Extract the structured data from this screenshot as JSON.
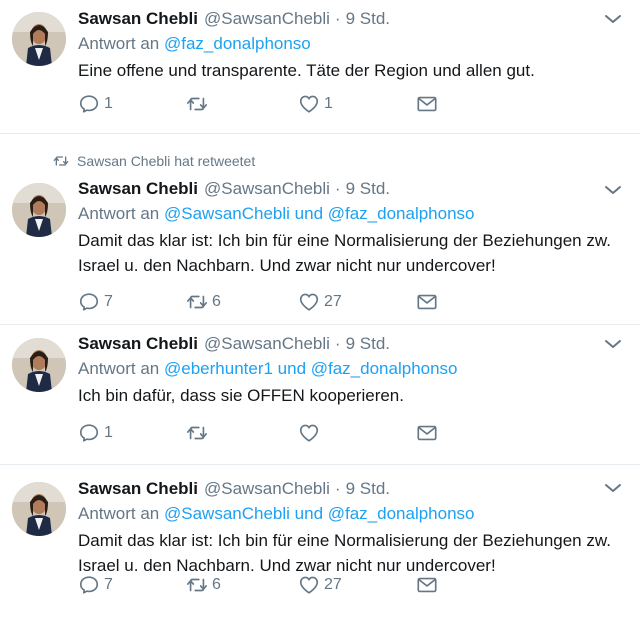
{
  "tweets": [
    {
      "retweeted_by": "",
      "display_name": "Sawsan Chebli",
      "handle": "@SawsanChebli",
      "separator": "·",
      "time": "9 Std.",
      "reply_prefix": "Antwort an",
      "reply_to": "@faz_donalphonso",
      "text": "Eine offene und transparente. Täte der Region und allen gut.",
      "reply_count": "1",
      "retweet_count": "",
      "like_count": "1"
    },
    {
      "retweeted_by": "Sawsan Chebli hat retweetet",
      "display_name": "Sawsan Chebli",
      "handle": "@SawsanChebli",
      "separator": "·",
      "time": "9 Std.",
      "reply_prefix": "Antwort an",
      "reply_to": "@SawsanChebli und @faz_donalphonso",
      "text": "Damit das klar ist: Ich bin für eine Normalisierung der Beziehungen zw. Israel u. den Nachbarn. Und zwar nicht nur undercover!",
      "reply_count": "7",
      "retweet_count": "6",
      "like_count": "27"
    },
    {
      "retweeted_by": "",
      "display_name": "Sawsan Chebli",
      "handle": "@SawsanChebli",
      "separator": "·",
      "time": "9 Std.",
      "reply_prefix": "Antwort an",
      "reply_to": "@eberhunter1 und @faz_donalphonso",
      "text": "Ich bin dafür, dass sie OFFEN kooperieren.",
      "reply_count": "1",
      "retweet_count": "",
      "like_count": ""
    },
    {
      "retweeted_by": "",
      "display_name": "Sawsan Chebli",
      "handle": "@SawsanChebli",
      "separator": "·",
      "time": "9 Std.",
      "reply_prefix": "Antwort an",
      "reply_to": "@SawsanChebli und @faz_donalphonso",
      "text": "Damit das klar ist: Ich bin für eine Normalisierung der Beziehungen zw. Israel u. den Nachbarn. Und zwar nicht nur undercover!",
      "reply_count": "7",
      "retweet_count": "6",
      "like_count": "27"
    }
  ],
  "icons": {
    "reply": "reply-icon",
    "retweet": "retweet-icon",
    "like": "heart-icon",
    "dm": "envelope-icon",
    "more": "chevron-down-icon"
  },
  "colors": {
    "accent": "#1da1f2",
    "secondary_text": "#657786",
    "primary_text": "#14171a",
    "divider": "#e6ecf0"
  }
}
